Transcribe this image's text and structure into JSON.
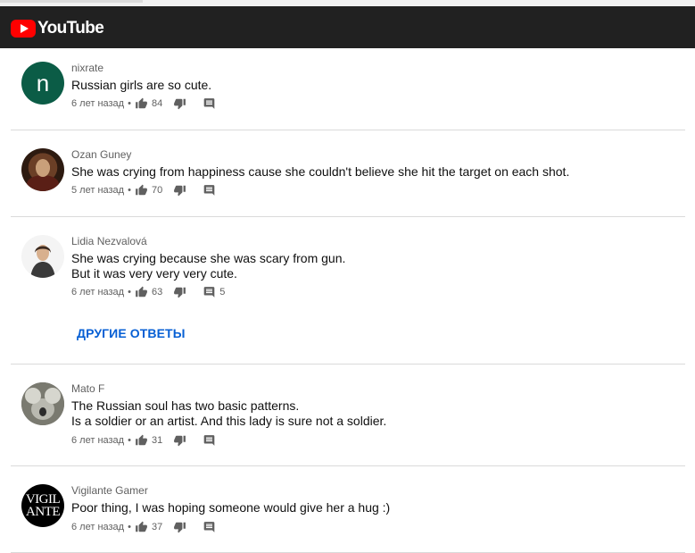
{
  "app": {
    "logo_text": "YouTube",
    "brand_color": "#ff0000"
  },
  "comments": [
    {
      "author": "nixrate",
      "lines": [
        "Russian girls are so cute."
      ],
      "time": "6 лет назад",
      "likes": "84",
      "replies": "",
      "avatar": {
        "letter": "n",
        "color": "#0b5c46"
      }
    },
    {
      "author": "Ozan Guney",
      "lines": [
        "She was crying from happiness cause she couldn't believe she hit the target on each shot."
      ],
      "time": "5 лет назад",
      "likes": "70",
      "replies": ""
    },
    {
      "author": "Lidia Nezvalová",
      "lines": [
        "She was crying because she was scary from gun.",
        "But it was very very very cute."
      ],
      "time": "6 лет назад",
      "likes": "63",
      "replies": "5",
      "more_replies": "ДРУГИЕ ОТВЕТЫ"
    },
    {
      "author": "Mato F",
      "lines": [
        "The Russian soul has two basic patterns.",
        "Is a soldier or an artist. And this lady is sure not a soldier."
      ],
      "time": "6 лет назад",
      "likes": "31",
      "replies": ""
    },
    {
      "author": "Vigilante Gamer",
      "lines": [
        "Poor thing, I was hoping someone would give her a hug :)"
      ],
      "time": "6 лет назад",
      "likes": "37",
      "replies": "",
      "avatar": {
        "line1": "VIGIL",
        "line2": "ANTE"
      }
    }
  ]
}
